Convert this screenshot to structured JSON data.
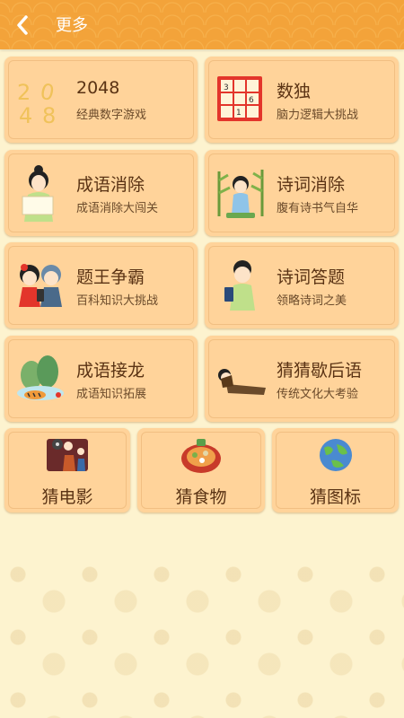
{
  "header": {
    "title": "更多"
  },
  "games": [
    {
      "title": "2048",
      "subtitle": "经典数字游戏",
      "icon": "2048-number-icon"
    },
    {
      "title": "数独",
      "subtitle": "脑力逻辑大挑战",
      "icon": "sudoku-grid-icon",
      "sudoku_digits": [
        "3",
        "6",
        "1"
      ]
    },
    {
      "title": "成语消除",
      "subtitle": "成语消除大闯关",
      "icon": "scholar-girl-scroll-icon"
    },
    {
      "title": "诗词消除",
      "subtitle": "腹有诗书气自华",
      "icon": "poet-bamboo-icon"
    },
    {
      "title": "题王争霸",
      "subtitle": "百科知识大挑战",
      "icon": "two-kids-phone-icon"
    },
    {
      "title": "诗词答题",
      "subtitle": "领略诗词之美",
      "icon": "scholar-boy-book-icon"
    },
    {
      "title": "成语接龙",
      "subtitle": "成语知识拓展",
      "icon": "tiger-landscape-icon"
    },
    {
      "title": "猜猜歇后语",
      "subtitle": "传统文化大考验",
      "icon": "reclining-scholar-icon"
    }
  ],
  "guess": [
    {
      "title": "猜电影",
      "icon": "movie-theater-icon"
    },
    {
      "title": "猜食物",
      "icon": "hotpot-food-icon"
    },
    {
      "title": "猜图标",
      "icon": "globe-icon"
    }
  ],
  "colors": {
    "header": "#f3a33a",
    "card": "#ffd39a",
    "text": "#5a3314",
    "background": "#fdf3cf"
  }
}
